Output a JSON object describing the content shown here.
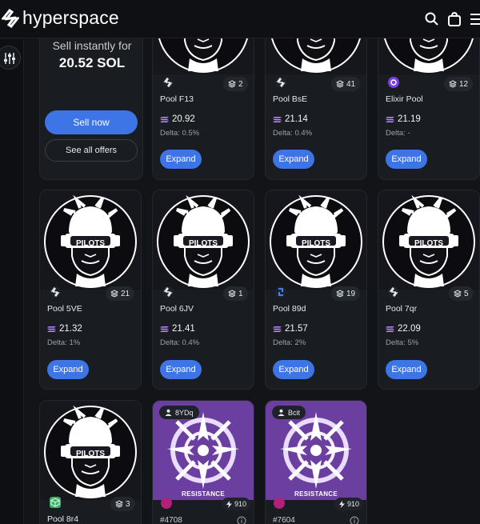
{
  "header": {
    "logo_text": "hyperspace",
    "icons": [
      "search-icon",
      "bag-icon",
      "menu-icon"
    ]
  },
  "sidebar": {
    "filter_icon": "sliders-icon"
  },
  "offer": {
    "title": "Sell instantly for",
    "price": "20.52 SOL",
    "sell_button": "Sell now",
    "offers_button": "See all offers"
  },
  "pools": [
    {
      "name": "Pool F13",
      "count": "2",
      "price": "20.92",
      "delta": "Delta: 0.5%",
      "expand": "Expand",
      "source": "hyperspace"
    },
    {
      "name": "Pool BsE",
      "count": "41",
      "price": "21.14",
      "delta": "Delta: 0.4%",
      "expand": "Expand",
      "source": "hyperspace"
    },
    {
      "name": "Elixir Pool",
      "count": "12",
      "price": "21.19",
      "delta": "Delta: -",
      "expand": "Expand",
      "source": "elixir"
    },
    {
      "name": "Pool 5VE",
      "count": "21",
      "price": "21.32",
      "delta": "Delta: 1%",
      "expand": "Expand",
      "source": "hyperspace"
    },
    {
      "name": "Pool 6JV",
      "count": "1",
      "price": "21.41",
      "delta": "Delta: 0.4%",
      "expand": "Expand",
      "source": "hyperspace"
    },
    {
      "name": "Pool 89d",
      "count": "19",
      "price": "21.57",
      "delta": "Delta: 2%",
      "expand": "Expand",
      "source": "swap"
    },
    {
      "name": "Pool 7qr",
      "count": "5",
      "price": "22.09",
      "delta": "Delta: 5%",
      "expand": "Expand",
      "source": "hyperspace"
    },
    {
      "name": "Pool 8r4",
      "count": "3",
      "source": "cube"
    }
  ],
  "artwork": {
    "pilots_text": "PILOTS",
    "resistance_text": "RESISTANCE"
  },
  "nfts": [
    {
      "owner": "8YDq",
      "rank": "910",
      "id": "#4708"
    },
    {
      "owner": "Bcit",
      "rank": "910",
      "id": "#7604"
    }
  ],
  "colors": {
    "accent": "#3d74e6",
    "background": "#121417",
    "card": "#191c21",
    "resistance_purple": "#6b3fa0"
  }
}
